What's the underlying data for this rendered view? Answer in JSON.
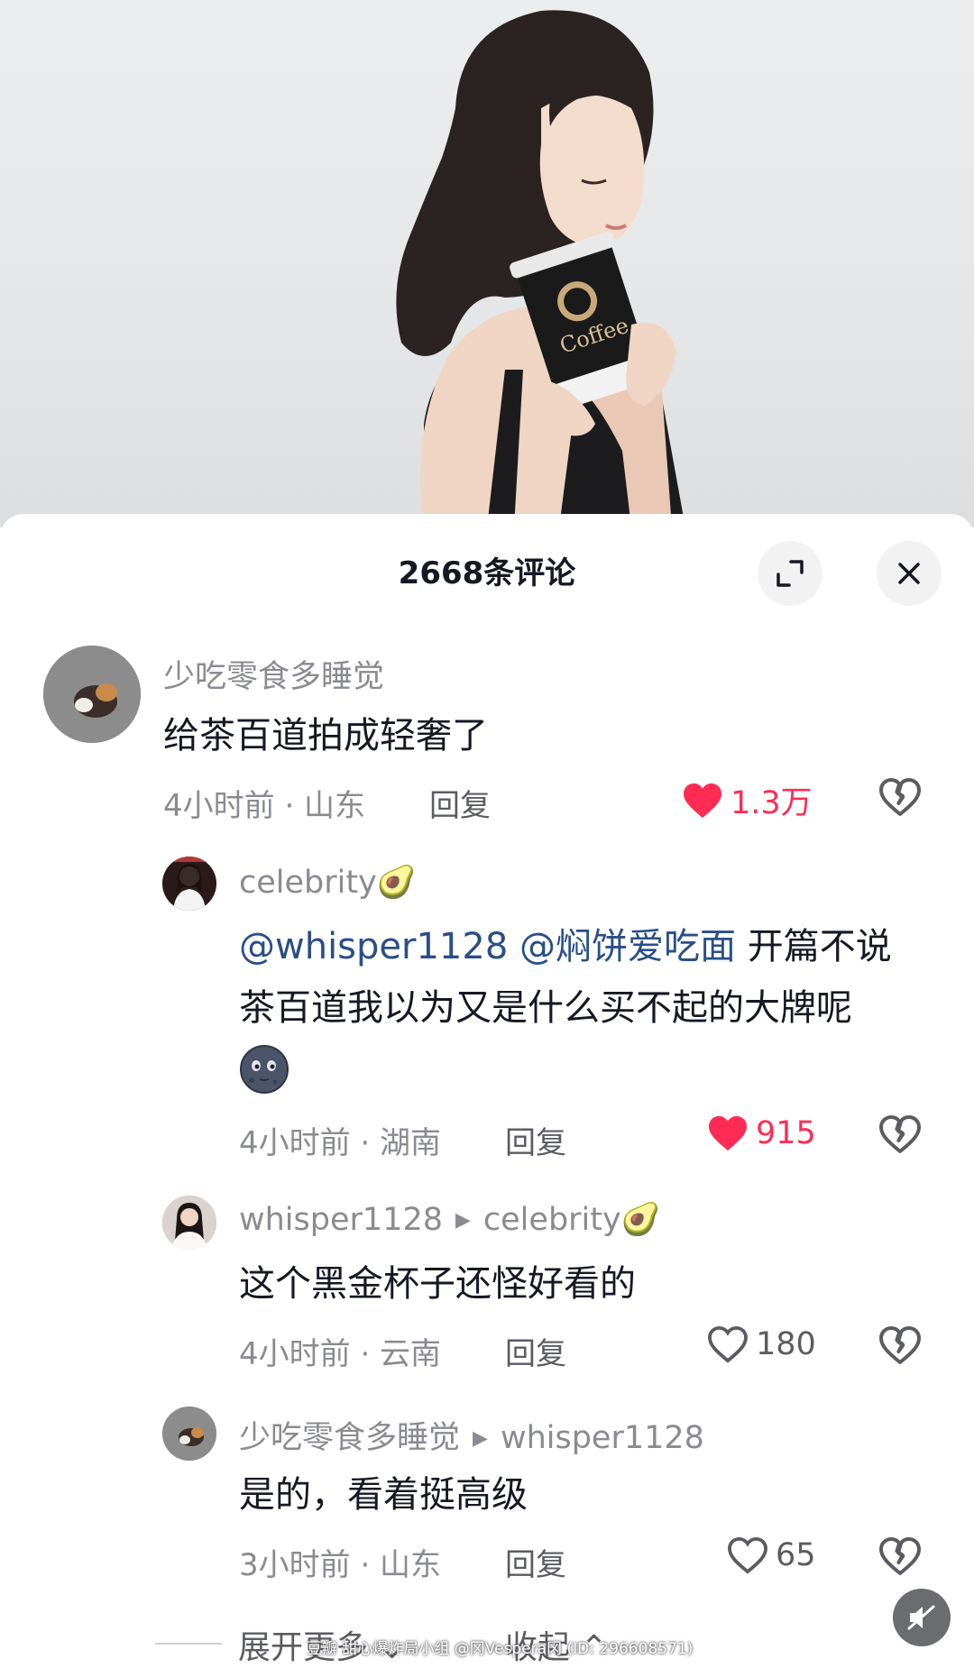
{
  "sheet": {
    "title": "2668条评论",
    "expand_icon": "expand-icon",
    "close_icon": "close-icon"
  },
  "comments": [
    {
      "username": "少吃零食多睡觉",
      "text": "给茶百道拍成轻奢了",
      "time_location": "4小时前 · 山东",
      "reply_label": "回复",
      "likes": "1.3万",
      "liked": true
    },
    {
      "username": "celebrity🥑",
      "mention1": "@whisper1128",
      "mention2": "@焖饼爱吃面",
      "text_line1_rest": " 开篇不说",
      "text_line2": "茶百道我以为又是什么买不起的大牌呢",
      "emoji": "moon-face-emoji",
      "time_location": "4小时前 · 湖南",
      "reply_label": "回复",
      "likes": "915",
      "liked": true
    },
    {
      "username": "whisper1128",
      "reply_to": "celebrity🥑",
      "text": "这个黑金杯子还怪好看的",
      "time_location": "4小时前 · 云南",
      "reply_label": "回复",
      "likes": "180",
      "liked": false
    },
    {
      "username": "少吃零食多睡觉",
      "reply_to": "whisper1128",
      "text": "是的，看着挺高级",
      "time_location": "3小时前 · 山东",
      "reply_label": "回复",
      "likes": "65",
      "liked": false
    }
  ],
  "footer": {
    "expand_more": "展开更多 ⌄",
    "collapse": "收起 ⌃",
    "watermark": "豆瓣 甜心爆炸局小组 @冈Vespera冈 (ID: 296608571)"
  },
  "colors": {
    "liked": "#fe2c55",
    "mention": "#2a4e87",
    "secondary_text": "#8a8b91"
  }
}
